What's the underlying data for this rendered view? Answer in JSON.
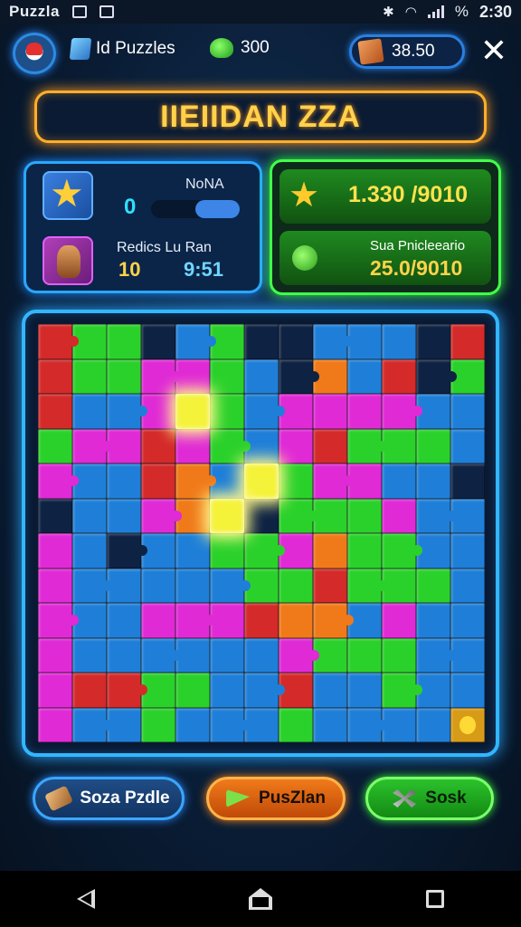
{
  "status_bar": {
    "app_label": "Puzzla",
    "battery": "%",
    "time": "2:30"
  },
  "top_bar": {
    "puzzles_label": "Id Puzzles",
    "gems_value": "300",
    "coins_value": "38.50"
  },
  "title": "IIEIIDAN ZZA",
  "stats": {
    "top_label": "NoNA",
    "progress_value": "0",
    "progress_fraction": 0.5,
    "second_label": "Redics Lu Ran",
    "second_value_a": "10",
    "second_value_b": "9:51",
    "stars_value": "1.330 /9010",
    "gems_label": "Sua Pnicleeario",
    "gems_value": "25.0/9010"
  },
  "board": {
    "columns": 13,
    "rows": 12,
    "palette": {
      "r": "#d42a2a",
      "g": "#2bd12b",
      "b": "#1f7fd8",
      "m": "#e02ad6",
      "o": "#f07a1a",
      "y": "#f5f23a",
      "k": "#0e2244",
      "p": "#2a9bd8"
    },
    "cells": [
      "rggkbgkkbbbkr",
      "rggmmgbkobrkg",
      "rbbmygbmmmmbb",
      "gmmrmgbmrgggb",
      "mbbrobygmmbbk",
      "kbbmoykgggmbb",
      "mbkbbggmoggbb",
      "mbbbbbggrgggb",
      "mbbmmmroobmbb",
      "mbbbbbbmgggbb",
      "mrrggbbrbbgbb",
      "mbbgbbbgbbbbo"
    ],
    "glow_cells": [
      [
        2,
        4
      ],
      [
        4,
        6
      ],
      [
        5,
        5
      ]
    ],
    "gold_cell": [
      11,
      12
    ]
  },
  "buttons": {
    "left": "Soza Pzdle",
    "middle": "PusZlan",
    "right": "Sosk"
  },
  "icons": {
    "avatar": "profile-avatar-icon",
    "puzzles": "puzzle-piece-icon",
    "gems": "green-gem-icon",
    "coins": "treasure-box-icon",
    "close": "close-icon"
  }
}
